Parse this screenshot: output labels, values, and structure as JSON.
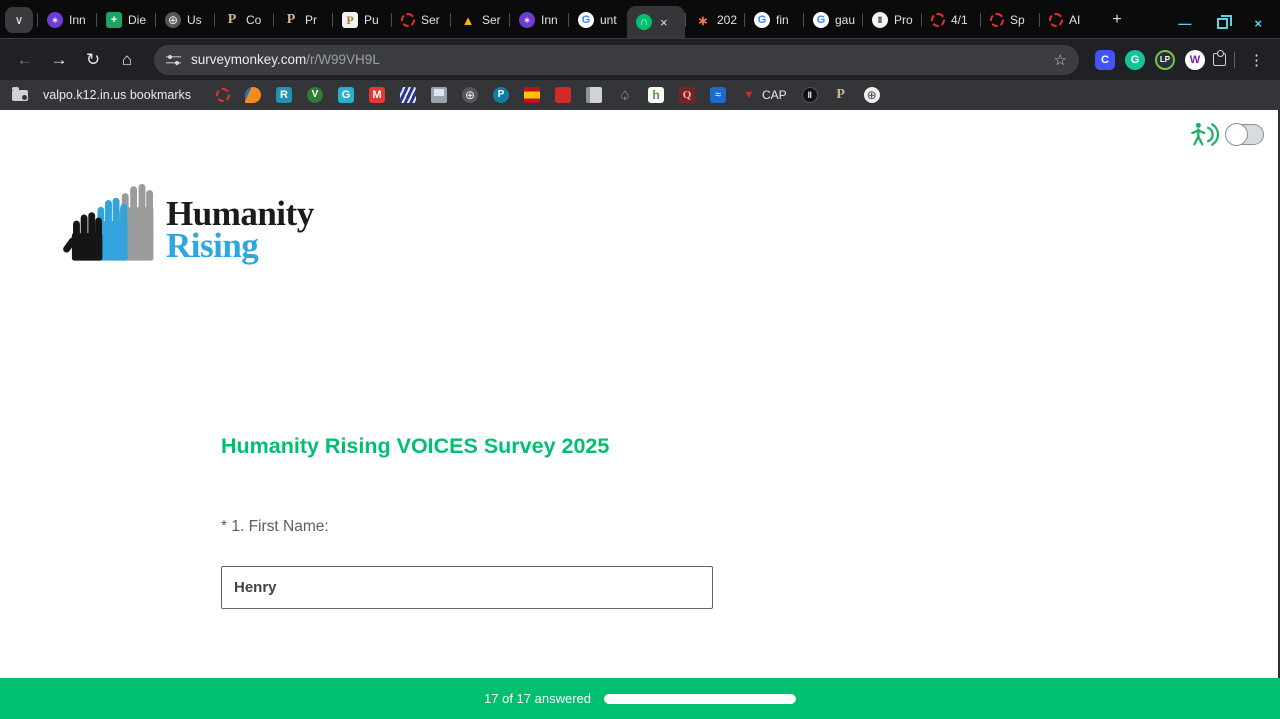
{
  "icons": {
    "chevron_down": "∨",
    "close": "×",
    "new_tab": "+",
    "minimize": "—",
    "back": "←",
    "forward": "→",
    "reload": "↻",
    "home": "⌂",
    "star": "☆",
    "kebab": "⋮"
  },
  "browser": {
    "tabs_before": [
      {
        "icon": "app-purple",
        "glyph": "∗",
        "label": "Inn"
      },
      {
        "icon": "sheets-green",
        "glyph": "+",
        "label": "Die"
      },
      {
        "icon": "globe-dark",
        "glyph": "⊕",
        "label": "Us"
      },
      {
        "icon": "purdue",
        "glyph": "P",
        "label": "Co"
      },
      {
        "icon": "purdue",
        "glyph": "P",
        "label": "Pr"
      },
      {
        "icon": "purdue-light",
        "glyph": "P",
        "label": "Pu"
      },
      {
        "icon": "red-dashed",
        "glyph": "",
        "label": "Ser"
      },
      {
        "icon": "drive",
        "glyph": "▲",
        "label": "Ser"
      },
      {
        "icon": "app-purple",
        "glyph": "∗",
        "label": "Inn"
      },
      {
        "icon": "google",
        "glyph": "G",
        "label": "unt"
      }
    ],
    "active_tab": {
      "icon": "surveymonkey",
      "glyph": "∩"
    },
    "tabs_after": [
      {
        "icon": "hubspot",
        "glyph": "∗",
        "label": "202"
      },
      {
        "icon": "google",
        "glyph": "G",
        "label": "fin"
      },
      {
        "icon": "google",
        "glyph": "G",
        "label": "gau"
      },
      {
        "icon": "bars-dark",
        "glyph": "‖",
        "label": "Pro"
      },
      {
        "icon": "red-dashed",
        "glyph": "",
        "label": "4/1"
      },
      {
        "icon": "red-dashed",
        "glyph": "",
        "label": "Sp"
      },
      {
        "icon": "red-dashed",
        "glyph": "",
        "label": "AI"
      }
    ],
    "url": {
      "host": "surveymonkey.com",
      "path": "/r/W99VH9L"
    },
    "extensions": [
      {
        "icon": "clever",
        "glyph": "C"
      },
      {
        "icon": "grammarly",
        "glyph": "G"
      },
      {
        "icon": "lp",
        "glyph": "LP"
      },
      {
        "icon": "w-colors",
        "glyph": "W"
      }
    ],
    "bookmarks": {
      "folder_label": "valpo.k12.in.us bookmarks",
      "items": [
        {
          "icon": "red-dashed",
          "glyph": "",
          "label": ""
        },
        {
          "icon": "flame",
          "glyph": "",
          "label": ""
        },
        {
          "icon": "r-teal",
          "glyph": "R",
          "label": ""
        },
        {
          "icon": "v-green",
          "glyph": "V",
          "label": ""
        },
        {
          "icon": "g-blue",
          "glyph": "G",
          "label": ""
        },
        {
          "icon": "m-red",
          "glyph": "M",
          "label": ""
        },
        {
          "icon": "stripes-navy",
          "glyph": "",
          "label": ""
        },
        {
          "icon": "computer",
          "glyph": "",
          "label": ""
        },
        {
          "icon": "globe-dark",
          "glyph": "⊕",
          "label": ""
        },
        {
          "icon": "p-teal",
          "glyph": "P",
          "label": ""
        },
        {
          "icon": "spain-flag",
          "glyph": "",
          "label": ""
        },
        {
          "icon": "red-figures",
          "glyph": "",
          "label": ""
        },
        {
          "icon": "book-gray",
          "glyph": "",
          "label": ""
        },
        {
          "icon": "acorn",
          "glyph": "♤",
          "label": ""
        },
        {
          "icon": "houzz",
          "glyph": "h",
          "label": ""
        },
        {
          "icon": "crest-maroon",
          "glyph": "Q",
          "label": ""
        },
        {
          "icon": "blue-square",
          "glyph": "≈",
          "label": ""
        },
        {
          "icon": "cap-bird",
          "glyph": "▼",
          "label": "CAP"
        },
        {
          "icon": "pause-black",
          "glyph": "‖",
          "label": ""
        },
        {
          "icon": "purdue",
          "glyph": "P",
          "label": ""
        },
        {
          "icon": "globe-light",
          "glyph": "⊕",
          "label": ""
        }
      ]
    }
  },
  "page": {
    "logo": {
      "line1": "Humanity",
      "line2": "Rising"
    },
    "title": "Humanity Rising VOICES Survey 2025",
    "question_label": "* 1. First Name:",
    "answer_value": "Henry",
    "footer": {
      "status": "17 of 17 answered",
      "progress_percent": 100
    },
    "colors": {
      "accent_green": "#00BF6F",
      "logo_blue": "#2ea7de"
    }
  }
}
